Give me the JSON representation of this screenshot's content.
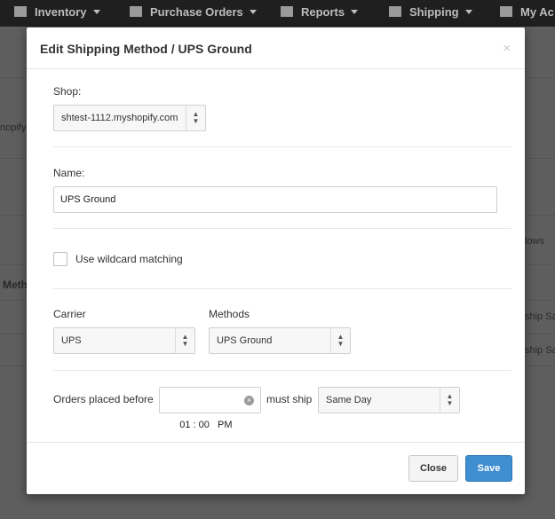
{
  "nav": {
    "items": [
      {
        "label": "Inventory",
        "icon": "tag-icon"
      },
      {
        "label": "Purchase Orders",
        "icon": "document-icon"
      },
      {
        "label": "Reports",
        "icon": "bar-chart-icon"
      },
      {
        "label": "Shipping",
        "icon": "truck-icon"
      },
      {
        "label": "My Ac",
        "icon": "wrench-icon"
      }
    ]
  },
  "background": {
    "left_fragment": "nopify.",
    "left_bold_fragment": "Meth",
    "right_fragments": [
      "lows",
      "ship Sa",
      "ship Sa"
    ]
  },
  "modal": {
    "title": "Edit Shipping Method / UPS Ground",
    "close_symbol": "×",
    "shop": {
      "label": "Shop:",
      "value": "shtest-1112.myshopify.com"
    },
    "name": {
      "label": "Name:",
      "value": "UPS Ground"
    },
    "wildcard": {
      "label": "Use wildcard matching",
      "checked": false
    },
    "carrier": {
      "label": "Carrier",
      "value": "UPS"
    },
    "methods": {
      "label": "Methods",
      "value": "UPS Ground"
    },
    "orders": {
      "label": "Orders placed before",
      "time_value": "01 : 00   PM",
      "must_ship_label": "must ship",
      "must_ship_value": "Same Day"
    },
    "footer": {
      "close_label": "Close",
      "save_label": "Save"
    }
  },
  "colors": {
    "primary": "#3e8ed0",
    "navbar": "#1f1f1f",
    "overlay": "#5f5f5f"
  }
}
